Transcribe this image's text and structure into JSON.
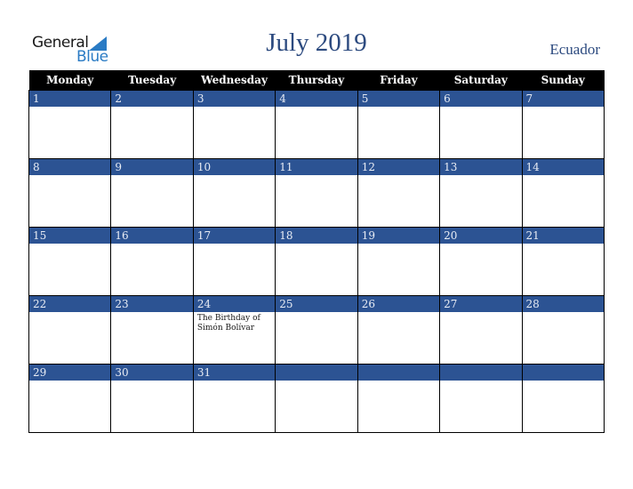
{
  "logo": {
    "line1": "General",
    "line2": "Blue"
  },
  "title": "July 2019",
  "country": "Ecuador",
  "weekdays": [
    "Monday",
    "Tuesday",
    "Wednesday",
    "Thursday",
    "Friday",
    "Saturday",
    "Sunday"
  ],
  "weeks": [
    [
      {
        "day": "1"
      },
      {
        "day": "2"
      },
      {
        "day": "3"
      },
      {
        "day": "4"
      },
      {
        "day": "5"
      },
      {
        "day": "6"
      },
      {
        "day": "7"
      }
    ],
    [
      {
        "day": "8"
      },
      {
        "day": "9"
      },
      {
        "day": "10"
      },
      {
        "day": "11"
      },
      {
        "day": "12"
      },
      {
        "day": "13"
      },
      {
        "day": "14"
      }
    ],
    [
      {
        "day": "15"
      },
      {
        "day": "16"
      },
      {
        "day": "17"
      },
      {
        "day": "18"
      },
      {
        "day": "19"
      },
      {
        "day": "20"
      },
      {
        "day": "21"
      }
    ],
    [
      {
        "day": "22"
      },
      {
        "day": "23"
      },
      {
        "day": "24",
        "event": "The Birthday of Simón Bolívar"
      },
      {
        "day": "25"
      },
      {
        "day": "26"
      },
      {
        "day": "27"
      },
      {
        "day": "28"
      }
    ],
    [
      {
        "day": "29"
      },
      {
        "day": "30"
      },
      {
        "day": "31"
      },
      {
        "day": ""
      },
      {
        "day": ""
      },
      {
        "day": ""
      },
      {
        "day": ""
      }
    ]
  ],
  "colors": {
    "header_bg": "#000000",
    "daynum_bg": "#2c5393",
    "title": "#2c4a7f",
    "logo_blue": "#2a7bc4"
  }
}
